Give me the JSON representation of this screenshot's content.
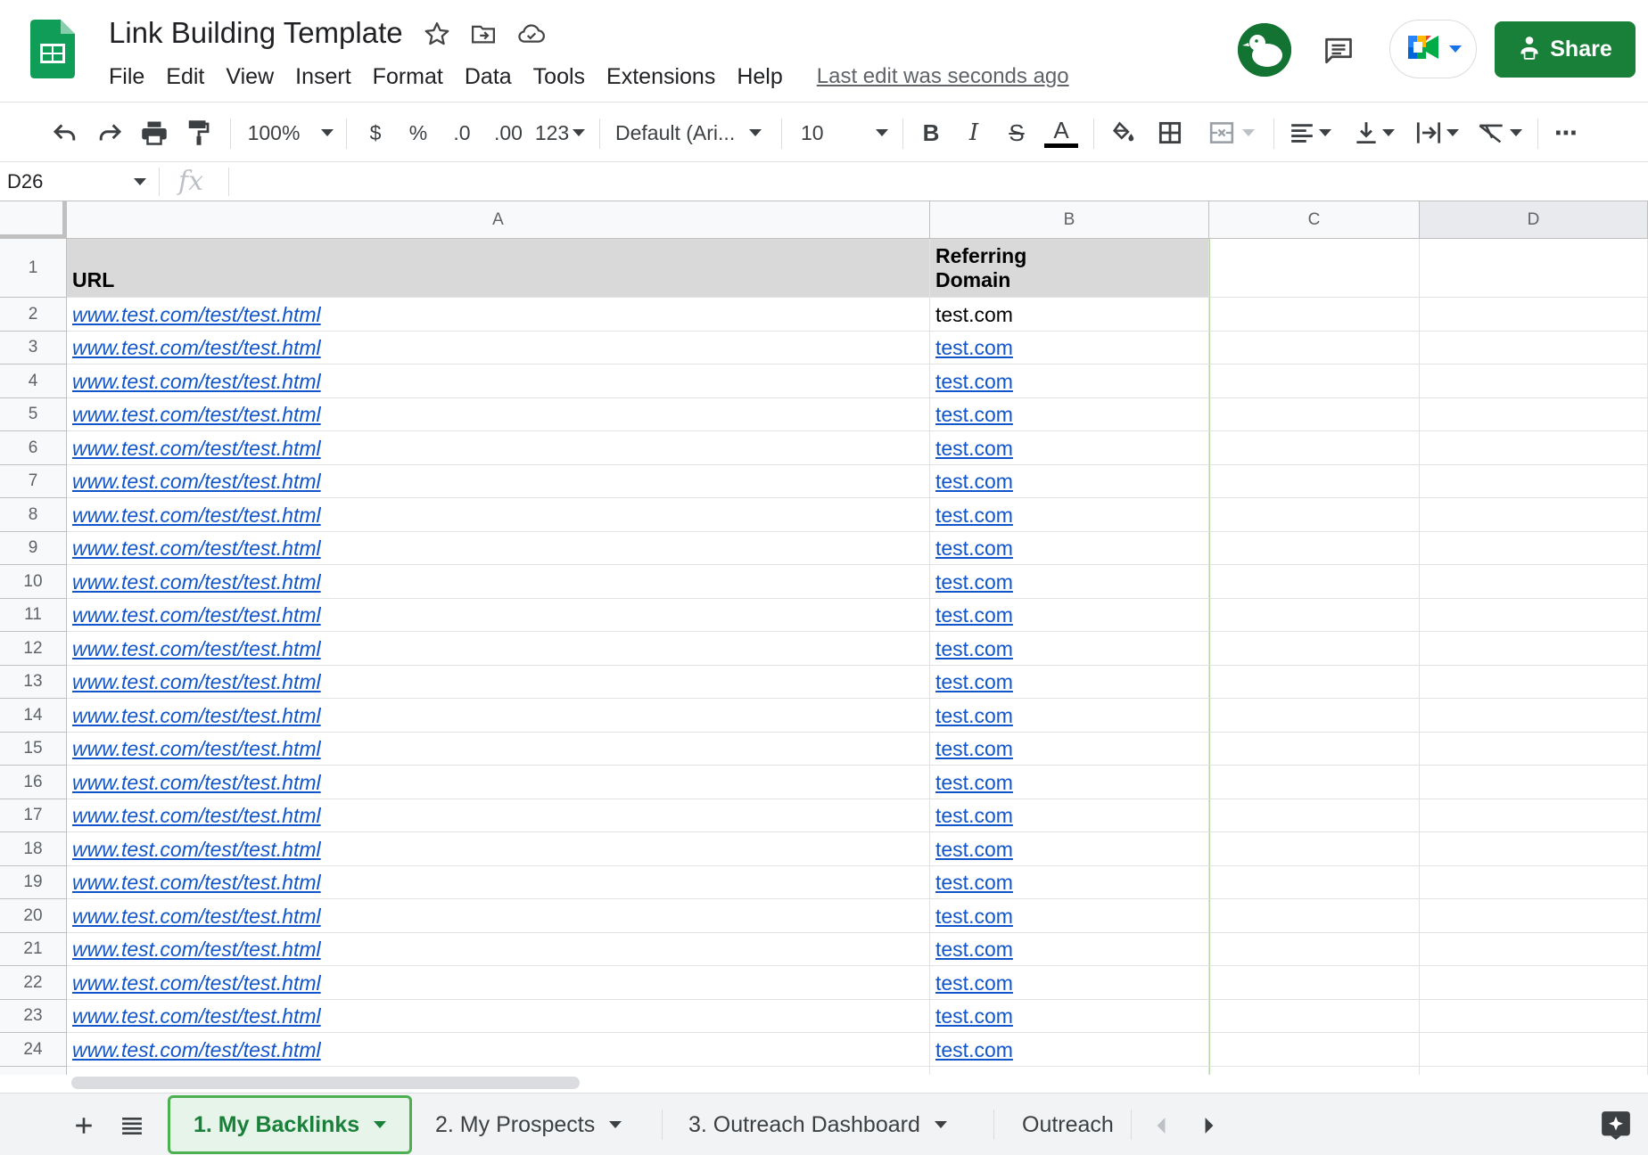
{
  "document": {
    "title": "Link Building Template",
    "last_edit": "Last edit was seconds ago"
  },
  "menu": [
    "File",
    "Edit",
    "View",
    "Insert",
    "Format",
    "Data",
    "Tools",
    "Extensions",
    "Help"
  ],
  "share": {
    "label": "Share",
    "color": "#188038"
  },
  "toolbar": {
    "zoom": "100%",
    "currency": "$",
    "percent": "%",
    "decrease_decimal": ".0",
    "increase_decimal": ".00",
    "number_format": "123",
    "font": "Default (Ari...",
    "font_size": "10",
    "bold": "B",
    "italic": "I",
    "strike": "S",
    "text_color": "A",
    "more": "⋯",
    "icons": [
      "undo-icon",
      "redo-icon",
      "print-icon",
      "paint-format-icon",
      "fill-color-icon",
      "borders-icon",
      "merge-cells-icon",
      "align-left-icon",
      "vertical-align-icon",
      "text-wrap-icon",
      "text-rotate-icon"
    ]
  },
  "formula_bar": {
    "cell_ref": "D26",
    "fx": "fx",
    "value": ""
  },
  "columns": [
    "A",
    "B",
    "C",
    "D"
  ],
  "rows": [
    "1",
    "2",
    "3",
    "4",
    "5",
    "6",
    "7",
    "8",
    "9",
    "10",
    "11",
    "12",
    "13",
    "14",
    "15",
    "16",
    "17",
    "18",
    "19",
    "20",
    "21",
    "22",
    "23",
    "24"
  ],
  "table": {
    "header": {
      "url": "URL",
      "domain_line1": "Referring",
      "domain_line2": "Domain"
    },
    "data": [
      {
        "url": "www.test.com/test/test.html",
        "domain": "test.com",
        "domain_linked": false
      },
      {
        "url": "www.test.com/test/test.html",
        "domain": "test.com",
        "domain_linked": true
      },
      {
        "url": "www.test.com/test/test.html",
        "domain": "test.com",
        "domain_linked": true
      },
      {
        "url": "www.test.com/test/test.html",
        "domain": "test.com",
        "domain_linked": true
      },
      {
        "url": "www.test.com/test/test.html",
        "domain": "test.com",
        "domain_linked": true
      },
      {
        "url": "www.test.com/test/test.html",
        "domain": "test.com",
        "domain_linked": true
      },
      {
        "url": "www.test.com/test/test.html",
        "domain": "test.com",
        "domain_linked": true
      },
      {
        "url": "www.test.com/test/test.html",
        "domain": "test.com",
        "domain_linked": true
      },
      {
        "url": "www.test.com/test/test.html",
        "domain": "test.com",
        "domain_linked": true
      },
      {
        "url": "www.test.com/test/test.html",
        "domain": "test.com",
        "domain_linked": true
      },
      {
        "url": "www.test.com/test/test.html",
        "domain": "test.com",
        "domain_linked": true
      },
      {
        "url": "www.test.com/test/test.html",
        "domain": "test.com",
        "domain_linked": true
      },
      {
        "url": "www.test.com/test/test.html",
        "domain": "test.com",
        "domain_linked": true
      },
      {
        "url": "www.test.com/test/test.html",
        "domain": "test.com",
        "domain_linked": true
      },
      {
        "url": "www.test.com/test/test.html",
        "domain": "test.com",
        "domain_linked": true
      },
      {
        "url": "www.test.com/test/test.html",
        "domain": "test.com",
        "domain_linked": true
      },
      {
        "url": "www.test.com/test/test.html",
        "domain": "test.com",
        "domain_linked": true
      },
      {
        "url": "www.test.com/test/test.html",
        "domain": "test.com",
        "domain_linked": true
      },
      {
        "url": "www.test.com/test/test.html",
        "domain": "test.com",
        "domain_linked": true
      },
      {
        "url": "www.test.com/test/test.html",
        "domain": "test.com",
        "domain_linked": true
      },
      {
        "url": "www.test.com/test/test.html",
        "domain": "test.com",
        "domain_linked": true
      },
      {
        "url": "www.test.com/test/test.html",
        "domain": "test.com",
        "domain_linked": true
      },
      {
        "url": "www.test.com/test/test.html",
        "domain": "test.com",
        "domain_linked": true
      }
    ]
  },
  "sheets": [
    {
      "label": "1. My Backlinks",
      "active": true
    },
    {
      "label": "2. My Prospects",
      "active": false
    },
    {
      "label": "3. Outreach Dashboard",
      "active": false
    },
    {
      "label": "Outreach",
      "active": false
    }
  ],
  "colors": {
    "accent": "#188038",
    "link": "#1155cc",
    "header_fill": "#d9d9d9"
  }
}
